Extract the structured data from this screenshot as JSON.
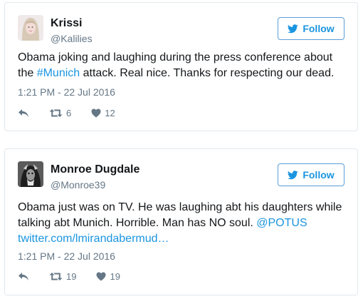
{
  "tweets": [
    {
      "name": "Krissi",
      "handle": "@Kalilies",
      "follow_label": "Follow",
      "text_parts": [
        "Obama joking and laughing during the press conference about the ",
        "#Munich",
        " attack. Real nice. Thanks for respecting our dead."
      ],
      "timestamp": "1:21 PM - 22 Jul 2016",
      "retweets": "6",
      "likes": "12"
    },
    {
      "name": "Monroe Dugdale",
      "handle": "@Monroe39",
      "follow_label": "Follow",
      "text_parts": [
        "Obama just was on TV. He was laughing abt his daughters while talking abt Munich. Horrible. Man has NO soul. ",
        "@POTUS",
        " ",
        "twitter.com/lmirandabermud…"
      ],
      "timestamp": "1:21 PM - 22 Jul 2016",
      "retweets": "19",
      "likes": "19"
    }
  ],
  "colors": {
    "accent": "#1b95e0",
    "muted": "#657786",
    "border": "#e1e8ed"
  },
  "icons": [
    "reply-icon",
    "retweet-icon",
    "heart-icon",
    "twitter-bird-icon"
  ]
}
